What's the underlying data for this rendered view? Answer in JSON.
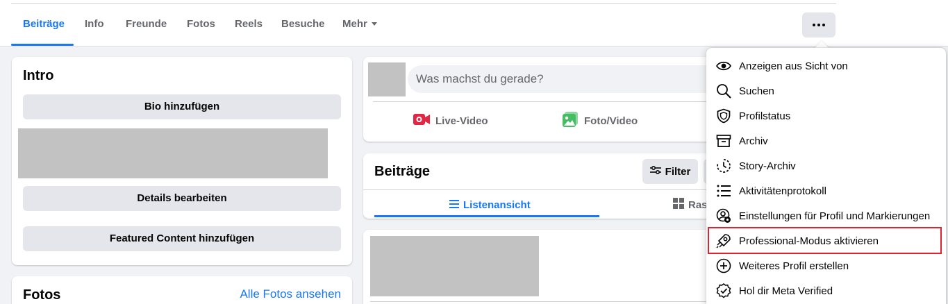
{
  "tabs": [
    {
      "label": "Beiträge",
      "active": true
    },
    {
      "label": "Info"
    },
    {
      "label": "Freunde"
    },
    {
      "label": "Fotos"
    },
    {
      "label": "Reels"
    },
    {
      "label": "Besuche"
    },
    {
      "label": "Mehr"
    }
  ],
  "intro": {
    "title": "Intro",
    "bio_button": "Bio hinzufügen",
    "details_button": "Details bearbeiten",
    "featured_button": "Featured Content hinzufügen"
  },
  "fotos": {
    "title": "Fotos",
    "link": "Alle Fotos ansehen"
  },
  "composer": {
    "placeholder": "Was machst du gerade?",
    "actions": [
      {
        "label": "Live-Video",
        "icon": "live-video-icon",
        "color": "#e42645"
      },
      {
        "label": "Foto/Video",
        "icon": "photo-video-icon",
        "color": "#45bd62"
      }
    ]
  },
  "posts": {
    "title": "Beiträge",
    "filter_label": "Filter",
    "views": [
      {
        "label": "Listenansicht",
        "active": true
      },
      {
        "label": "Rast"
      }
    ]
  },
  "menu": {
    "items": [
      {
        "label": "Anzeigen aus Sicht von",
        "icon": "eye-icon"
      },
      {
        "label": "Suchen",
        "icon": "search-icon"
      },
      {
        "label": "Profilstatus",
        "icon": "shield-icon"
      },
      {
        "label": "Archiv",
        "icon": "archive-icon"
      },
      {
        "label": "Story-Archiv",
        "icon": "story-archive-icon"
      },
      {
        "label": "Aktivitätenprotokoll",
        "icon": "activity-list-icon"
      },
      {
        "label": "Einstellungen für Profil und Markierungen",
        "icon": "profile-settings-icon"
      },
      {
        "label": "Professional-Modus aktivieren",
        "icon": "professional-mode-icon",
        "highlighted": true
      },
      {
        "label": "Weiteres Profil erstellen",
        "icon": "plus-circle-icon"
      },
      {
        "label": "Hol dir Meta Verified",
        "icon": "verified-badge-icon"
      }
    ]
  },
  "colors": {
    "accent": "#1877f2",
    "highlight_border": "#e0242f"
  }
}
